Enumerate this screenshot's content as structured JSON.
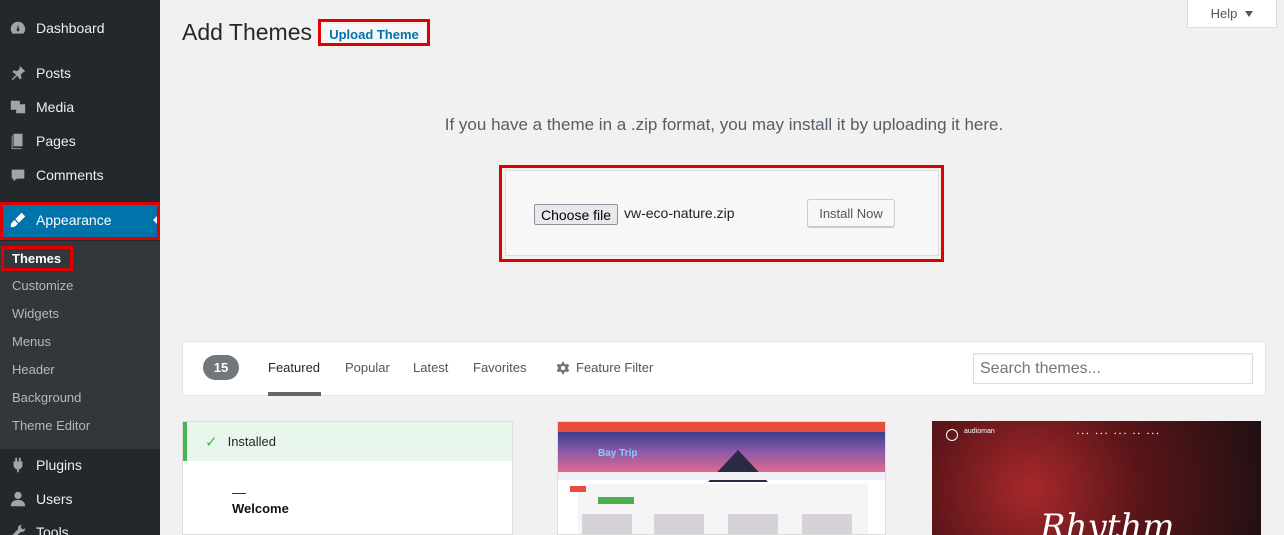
{
  "sidebar": {
    "items": [
      {
        "label": "Dashboard",
        "icon": "dashboard-icon"
      },
      {
        "label": "Posts",
        "icon": "pin-icon"
      },
      {
        "label": "Media",
        "icon": "media-icon"
      },
      {
        "label": "Pages",
        "icon": "pages-icon"
      },
      {
        "label": "Comments",
        "icon": "comment-icon"
      },
      {
        "label": "Appearance",
        "icon": "brush-icon"
      },
      {
        "label": "Plugins",
        "icon": "plugin-icon"
      },
      {
        "label": "Users",
        "icon": "users-icon"
      },
      {
        "label": "Tools",
        "icon": "tools-icon"
      }
    ],
    "submenu": [
      "Themes",
      "Customize",
      "Widgets",
      "Menus",
      "Header",
      "Background",
      "Theme Editor"
    ]
  },
  "header": {
    "title": "Add Themes",
    "upload_label": "Upload Theme",
    "help_label": "Help"
  },
  "upload": {
    "description": "If you have a theme in a .zip format, you may install it by uploading it here.",
    "choose_label": "Choose file",
    "file_name": "vw-eco-nature.zip",
    "install_label": "Install Now"
  },
  "filter": {
    "count": "15",
    "tabs": [
      "Featured",
      "Popular",
      "Latest",
      "Favorites"
    ],
    "feature_filter_label": "Feature Filter",
    "search_placeholder": "Search themes..."
  },
  "themes": {
    "installed_label": "Installed",
    "card1_heading": "Welcome",
    "card2_logo": "Bay Trip",
    "card3_brand": "audioman",
    "card3_script": "Rhythm"
  },
  "colors": {
    "sidebar_bg": "#23282d",
    "active_blue": "#0073aa",
    "highlight_red": "#e00000",
    "installed_green": "#46b450"
  }
}
